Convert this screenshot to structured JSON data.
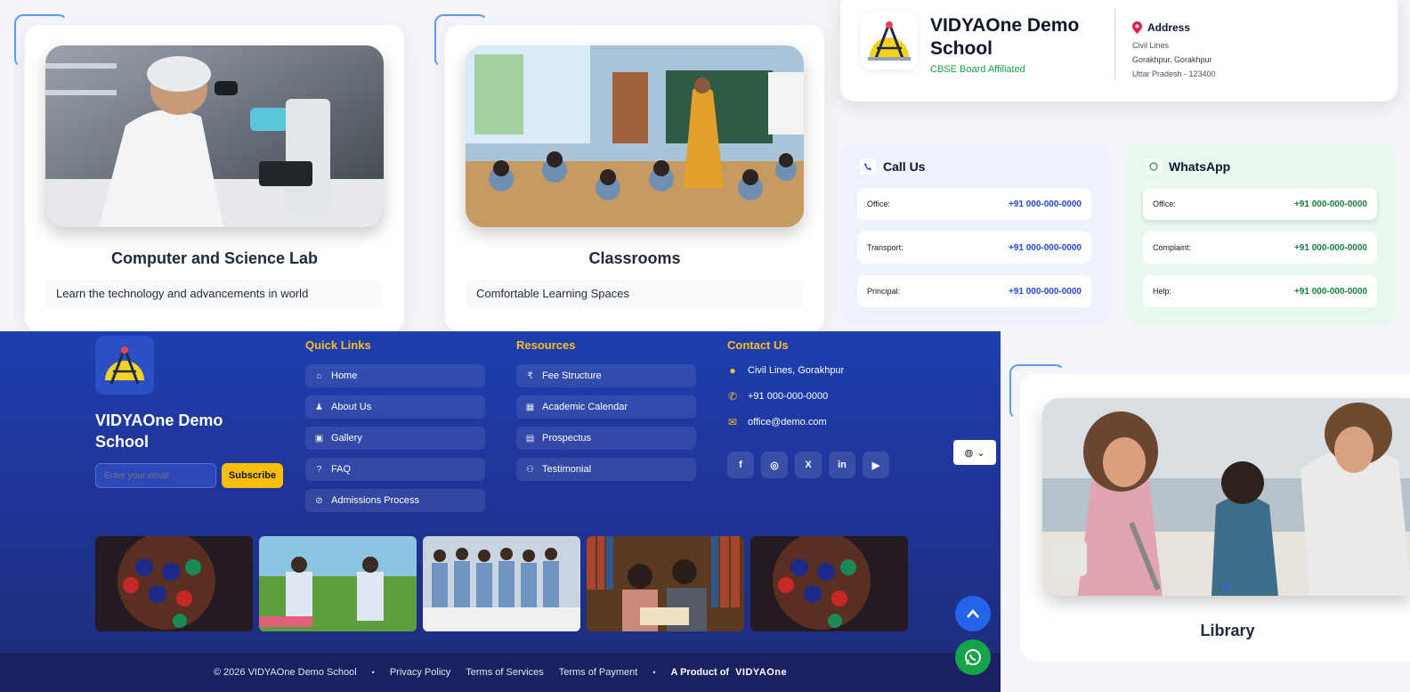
{
  "facilities": [
    {
      "title": "Computer and Science Lab",
      "description": "Learn the technology and advancements in world"
    },
    {
      "title": "Classrooms",
      "description": "Comfortable Learning Spaces"
    },
    {
      "title": "Library"
    }
  ],
  "school": {
    "name": "VIDYAOne Demo School",
    "board": "CBSE Board Affiliated",
    "address": {
      "heading": "Address",
      "line1": "Civil Lines",
      "line2": "Gorakhpur, Gorakhpur",
      "line3": "Uttar Pradesh - 123400"
    }
  },
  "call_us": {
    "heading": "Call Us",
    "rows": [
      {
        "label": "Office:",
        "number": "+91 000-000-0000"
      },
      {
        "label": "Transport:",
        "number": "+91 000-000-0000"
      },
      {
        "label": "Principal:",
        "number": "+91 000-000-0000"
      }
    ]
  },
  "whatsapp": {
    "heading": "WhatsApp",
    "rows": [
      {
        "label": "Office:",
        "number": "+91 000-000-0000"
      },
      {
        "label": "Complaint:",
        "number": "+91 000-000-0000"
      },
      {
        "label": "Help:",
        "number": "+91 000-000-0000"
      }
    ]
  },
  "footer": {
    "school_name": "VIDYAOne Demo School",
    "email_placeholder": "Enter your email",
    "subscribe_label": "Subscribe",
    "quick_links": {
      "heading": "Quick Links",
      "items": [
        "Home",
        "About Us",
        "Gallery",
        "FAQ",
        "Admissions Process"
      ]
    },
    "resources": {
      "heading": "Resources",
      "items": [
        "Fee Structure",
        "Academic Calendar",
        "Prospectus",
        "Testimonial"
      ]
    },
    "contact": {
      "heading": "Contact Us",
      "location": "Civil Lines, Gorakhpur",
      "phone": "+91 000-000-0000",
      "email": "office@demo.com"
    },
    "social_icons": [
      "facebook-icon",
      "instagram-icon",
      "x-icon",
      "linkedin-icon",
      "youtube-icon"
    ],
    "bottom": {
      "copyright": "© 2026 VIDYAOne Demo School",
      "privacy": "Privacy Policy",
      "terms_services": "Terms of Services",
      "terms_payment": "Terms of Payment",
      "product_of": "A Product of",
      "brand": "VIDYAOne"
    }
  },
  "colors": {
    "footer_blue": "#1e3fae",
    "accent_yellow": "#fbbf24",
    "call_blue": "#2347d9",
    "whatsapp_green": "#15803d"
  }
}
